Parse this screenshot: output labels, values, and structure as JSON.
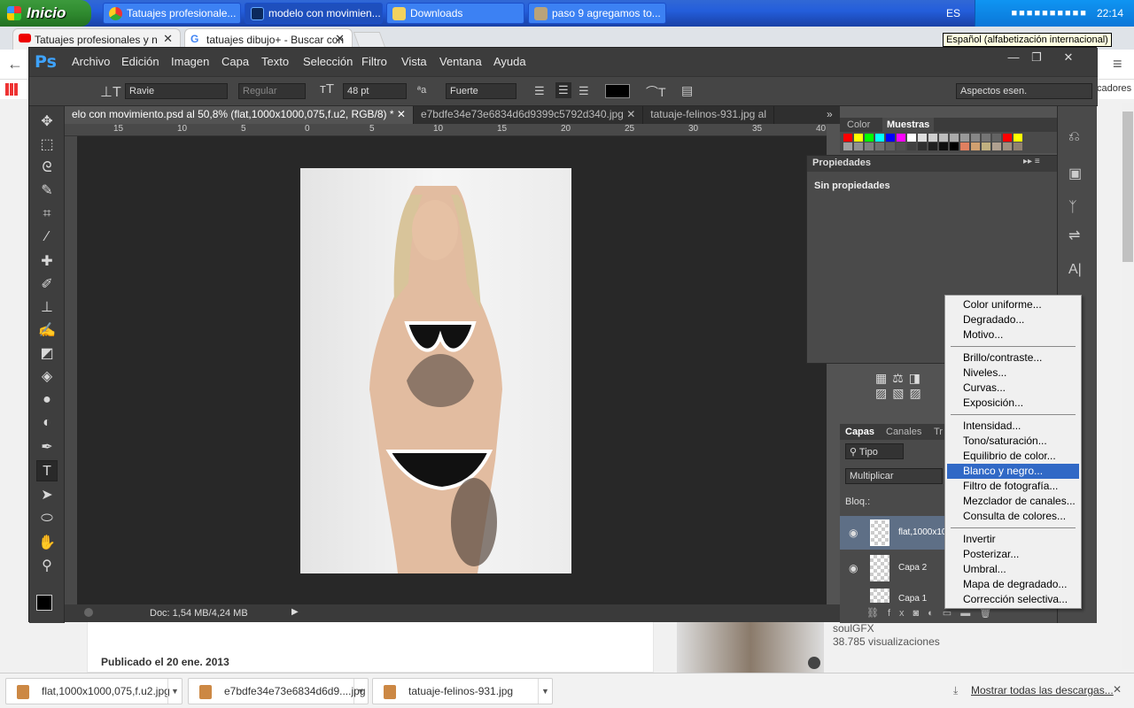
{
  "taskbar": {
    "start": "Inicio",
    "tasks": [
      "Tatuajes profesionale...",
      "modelo con movimien...",
      "Downloads",
      "paso 9 agregamos to..."
    ],
    "lang": "ES",
    "clock": "22:14"
  },
  "chrome": {
    "tabs": [
      {
        "label": "Tatuajes profesionales y n"
      },
      {
        "label": "tatuajes dibujo+ - Buscar con"
      }
    ],
    "tooltip": "Español (alfabetización internacional)",
    "bookmarks_right": "cadores"
  },
  "web": {
    "published": "Publicado el 20 ene. 2013",
    "channel": "soulGFX",
    "views": "38.785 visualizaciones"
  },
  "ps": {
    "logo": "Ps",
    "menu": [
      "Archivo",
      "Edición",
      "Imagen",
      "Capa",
      "Texto",
      "Selección",
      "Filtro",
      "Vista",
      "Ventana",
      "Ayuda"
    ],
    "options": {
      "font": "Ravie",
      "style": "Regular",
      "size": "48 pt",
      "aa_icon": "ªa",
      "antialias": "Fuerte",
      "workspace": "Aspectos esen."
    },
    "doctabs": [
      "elo con movimiento.psd al 50,8% (flat,1000x1000,075,f.u2, RGB/8) *",
      "e7bdfe34e73e6834d6d9399c5792d340.jpg",
      "tatuaje-felinos-931.jpg al"
    ],
    "ruler": [
      "15",
      "10",
      "5",
      "0",
      "5",
      "10",
      "15",
      "20",
      "25",
      "30",
      "35",
      "40"
    ],
    "status": "Doc: 1,54 MB/4,24 MB",
    "panels": {
      "color_tab": "Color",
      "swatches_tab": "Muestras",
      "props_title": "Propiedades",
      "props_body": "Sin propiedades",
      "layers_tab": "Capas",
      "channels_tab": "Canales",
      "paths_tab": "Tr",
      "filter": "Tipo",
      "blend": "Multiplicar",
      "lock": "Bloq.:",
      "layers": [
        "flat,1000x10",
        "Capa 2",
        "Capa 1"
      ]
    },
    "swatches": [
      "#ff0000",
      "#ffff00",
      "#00ff00",
      "#00ffff",
      "#0000ff",
      "#ff00ff",
      "#ffffff",
      "#e0e0e0",
      "#cfcfcf",
      "#bdbdbd",
      "#ababab",
      "#999999",
      "#878787",
      "#757575",
      "#636363",
      "#ff0000",
      "#ffff00"
    ],
    "swatches2": [
      "#a0a0a0",
      "#909090",
      "#808080",
      "#707070",
      "#606060",
      "#505050",
      "#404040",
      "#303030",
      "#202020",
      "#101010",
      "#000000",
      "#e08060",
      "#d0a070",
      "#c0b080",
      "#b0a090",
      "#a09080",
      "#908070"
    ]
  },
  "context_menu": {
    "groups": [
      [
        "Color uniforme...",
        "Degradado...",
        "Motivo..."
      ],
      [
        "Brillo/contraste...",
        "Niveles...",
        "Curvas...",
        "Exposición..."
      ],
      [
        "Intensidad...",
        "Tono/saturación...",
        "Equilibrio de color...",
        "Blanco y negro...",
        "Filtro de fotografía...",
        "Mezclador de canales...",
        "Consulta de colores..."
      ],
      [
        "Invertir",
        "Posterizar...",
        "Umbral...",
        "Mapa de degradado...",
        "Corrección selectiva..."
      ]
    ],
    "highlighted": "Blanco y negro..."
  },
  "downloads": {
    "items": [
      "flat,1000x1000,075,f.u2.jpg",
      "e7bdfe34e73e6834d6d9....jpg",
      "tatuaje-felinos-931.jpg"
    ],
    "show_all": "Mostrar todas las descargas..."
  }
}
